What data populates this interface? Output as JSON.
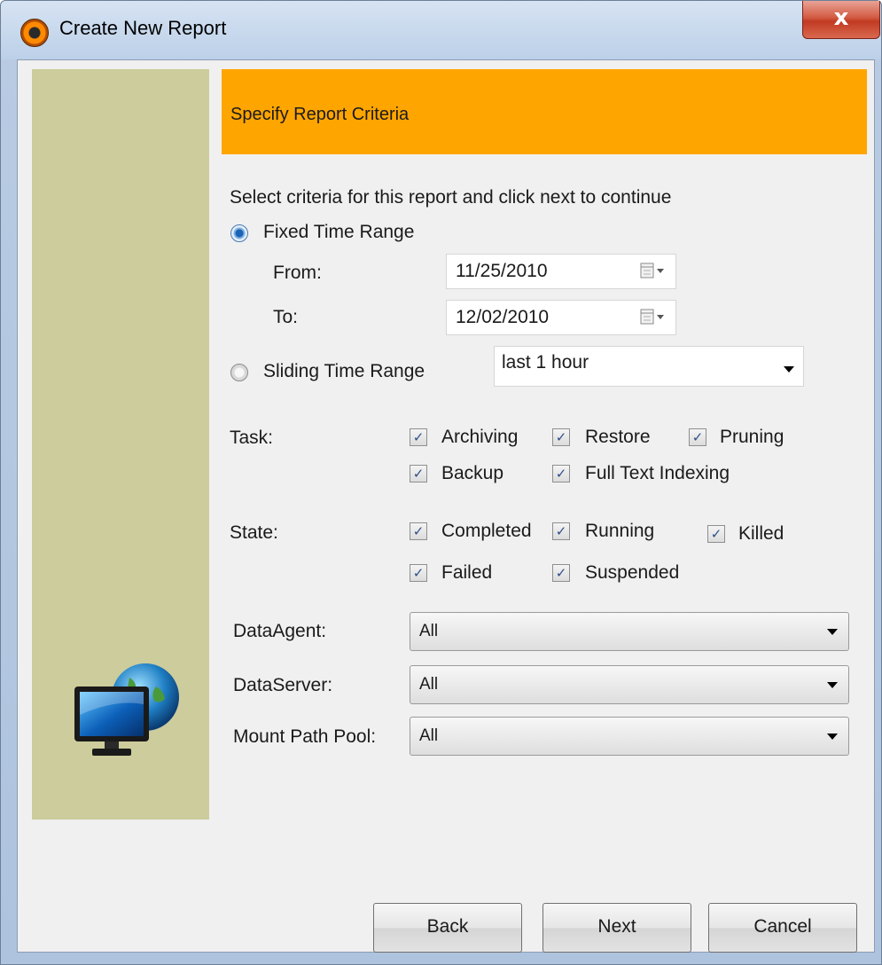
{
  "window": {
    "title": "Create New Report",
    "close_label": "x"
  },
  "header": {
    "title": "Specify Report Criteria",
    "instruction": "Select criteria for this report and click next to continue"
  },
  "time_range": {
    "fixed_label": "Fixed Time Range",
    "fixed_selected": true,
    "from_label": "From:",
    "from_value": "11/25/2010",
    "to_label": "To:",
    "to_value": "12/02/2010",
    "sliding_label": "Sliding Time Range",
    "sliding_selected": false,
    "sliding_value": "last 1 hour"
  },
  "task": {
    "label": "Task:",
    "options": [
      {
        "label": "Archiving",
        "checked": true
      },
      {
        "label": "Restore",
        "checked": true
      },
      {
        "label": "Pruning",
        "checked": true
      },
      {
        "label": "Backup",
        "checked": true
      },
      {
        "label": "Full Text Indexing",
        "checked": true
      }
    ]
  },
  "state": {
    "label": "State:",
    "options": [
      {
        "label": "Completed",
        "checked": true
      },
      {
        "label": "Running",
        "checked": true
      },
      {
        "label": "Killed",
        "checked": true
      },
      {
        "label": "Failed",
        "checked": true
      },
      {
        "label": "Suspended",
        "checked": true
      }
    ]
  },
  "filters": {
    "data_agent_label": "DataAgent:",
    "data_agent_value": "All",
    "data_server_label": "DataServer:",
    "data_server_value": "All",
    "mount_path_label": "Mount Path Pool:",
    "mount_path_value": "All"
  },
  "buttons": {
    "back": "Back",
    "next": "Next",
    "cancel": "Cancel"
  },
  "colors": {
    "banner": "#ffa500",
    "side_panel": "#cdcc9c",
    "close_button": "#c13a22"
  },
  "icons": {
    "app": "app-icon",
    "close": "close-icon",
    "calendar": "calendar-icon",
    "dropdown": "chevron-down-icon",
    "monitor": "monitor-globe-icon"
  }
}
